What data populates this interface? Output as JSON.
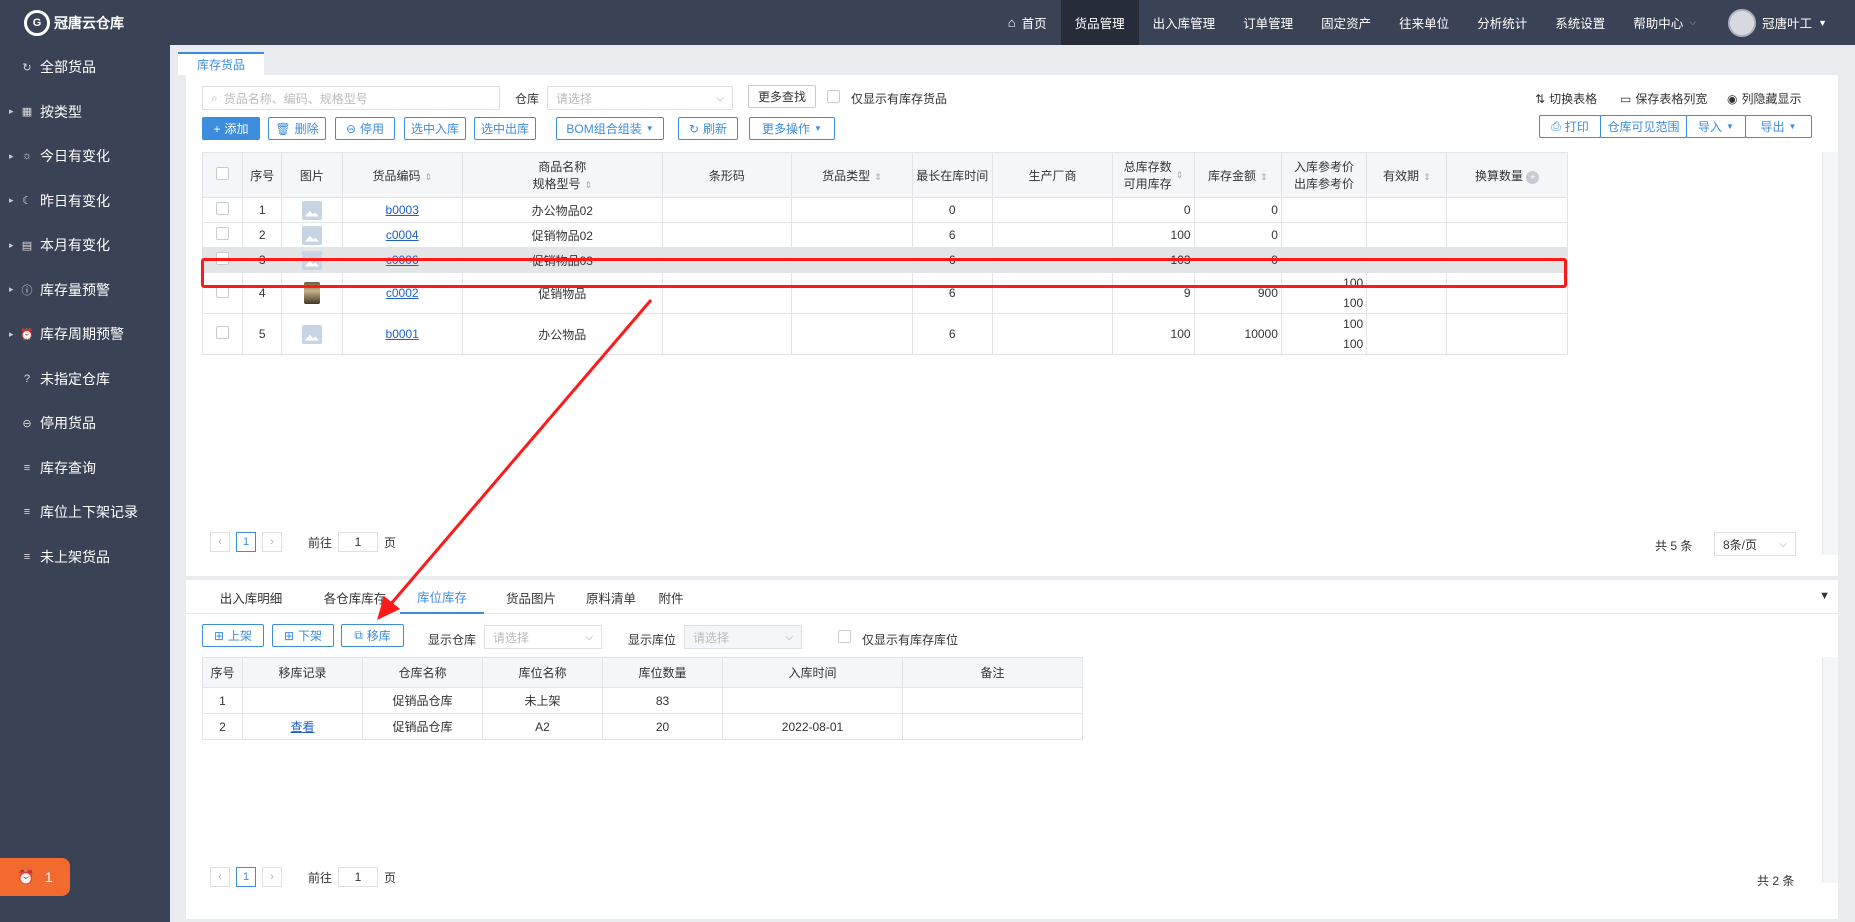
{
  "app": {
    "title": "冠唐云仓库",
    "logo_text": "G"
  },
  "sidebar": {
    "items": [
      {
        "label": "全部货品",
        "icon": "refresh-icon",
        "glyph": "↻",
        "arrow": ""
      },
      {
        "label": "按类型",
        "icon": "grid-icon",
        "glyph": "▦",
        "arrow": "▸"
      },
      {
        "label": "今日有变化",
        "icon": "sun-icon",
        "glyph": "☼",
        "arrow": "▸"
      },
      {
        "label": "昨日有变化",
        "icon": "moon-icon",
        "glyph": "☾",
        "arrow": "▸"
      },
      {
        "label": "本月有变化",
        "icon": "calendar-icon",
        "glyph": "▤",
        "arrow": "▸"
      },
      {
        "label": "库存量预警",
        "icon": "alert-icon",
        "glyph": "ⓘ",
        "arrow": "▸"
      },
      {
        "label": "库存周期预警",
        "icon": "alarm-clock-icon",
        "glyph": "⏰",
        "arrow": "▸"
      },
      {
        "label": "未指定仓库",
        "icon": "question-icon",
        "glyph": "?",
        "arrow": ""
      },
      {
        "label": "停用货品",
        "icon": "minus-circle-icon",
        "glyph": "⊖",
        "arrow": ""
      },
      {
        "label": "库存查询",
        "icon": "list-icon",
        "glyph": "≡",
        "arrow": ""
      },
      {
        "label": "库位上下架记录",
        "icon": "list-icon",
        "glyph": "≡",
        "arrow": ""
      },
      {
        "label": "未上架货品",
        "icon": "list-icon",
        "glyph": "≡",
        "arrow": ""
      }
    ],
    "alarm_count": "1"
  },
  "topnav": {
    "items": [
      "首页",
      "货品管理",
      "出入库管理",
      "订单管理",
      "固定资产",
      "往来单位",
      "分析统计",
      "系统设置",
      "帮助中心"
    ],
    "active_index": 1,
    "user_name": "冠唐叶工"
  },
  "page_tab": "库存货品",
  "toolbar": {
    "search_placeholder": "货品名称、编码、规格型号",
    "warehouse_label": "仓库",
    "warehouse_placeholder": "请选择",
    "more_search": "更多查找",
    "only_stock_label": "仅显示有库存货品",
    "switch_table": "切换表格",
    "save_width": "保存表格列宽",
    "hide_columns": "列隐藏显示",
    "buttons": [
      "添加",
      "删除",
      "停用",
      "选中入库",
      "选中出库",
      "BOM组合组装",
      "刷新",
      "更多操作"
    ],
    "right_buttons": [
      "打印",
      "仓库可见范围",
      "导入",
      "导出"
    ]
  },
  "goods_table": {
    "headers": {
      "seq": "序号",
      "img": "图片",
      "code": "货品编码",
      "name1": "商品名称",
      "name2": "规格型号",
      "barcode": "条形码",
      "type": "货品类型",
      "longest": "最长在库时间",
      "maker": "生产厂商",
      "stock1": "总库存数",
      "stock2": "可用库存",
      "amount": "库存金额",
      "ref1": "入库参考价",
      "ref2": "出库参考价",
      "expiry": "有效期",
      "convert": "换算数量"
    },
    "rows": [
      {
        "seq": "1",
        "code": "b0003",
        "name": "办公物品02",
        "longest": "0",
        "stock": "0",
        "amount": "0",
        "in_price": "",
        "out_price": "",
        "img": "placeholder"
      },
      {
        "seq": "2",
        "code": "c0004",
        "name": "促销物品02",
        "longest": "6",
        "stock": "100",
        "amount": "0",
        "in_price": "",
        "out_price": "",
        "img": "placeholder"
      },
      {
        "seq": "3",
        "code": "c0006",
        "name": "促销物品03",
        "longest": "6",
        "stock": "103",
        "amount": "0",
        "in_price": "",
        "out_price": "",
        "img": "placeholder"
      },
      {
        "seq": "4",
        "code": "c0002",
        "name": "促销物品",
        "longest": "6",
        "stock": "9",
        "amount": "900",
        "in_price": "100",
        "out_price": "100",
        "img": "book"
      },
      {
        "seq": "5",
        "code": "b0001",
        "name": "办公物品",
        "longest": "6",
        "stock": "100",
        "amount": "10000",
        "in_price": "100",
        "out_price": "100",
        "img": "placeholder"
      }
    ],
    "selected_row": 2
  },
  "pager_top": {
    "current": "1",
    "goto_label": "前往",
    "goto_value": "1",
    "page_suffix": "页",
    "total": "共 5 条",
    "page_size": "8条/页"
  },
  "bottom": {
    "tabs": [
      "出入库明细",
      "各仓库库存",
      "库位库存",
      "货品图片",
      "原料清单",
      "附件"
    ],
    "active_tab": 2,
    "buttons": [
      "上架",
      "下架",
      "移库"
    ],
    "show_warehouse_label": "显示仓库",
    "show_warehouse_placeholder": "请选择",
    "show_location_label": "显示库位",
    "show_location_placeholder": "请选择",
    "only_stock_location": "仅显示有库存库位",
    "headers": [
      "序号",
      "移库记录",
      "仓库名称",
      "库位名称",
      "库位数量",
      "入库时间",
      "备注"
    ],
    "rows": [
      [
        "1",
        "",
        "促销品仓库",
        "未上架",
        "83",
        "",
        ""
      ],
      [
        "2",
        "查看",
        "促销品仓库",
        "A2",
        "20",
        "2022-08-01",
        ""
      ]
    ]
  },
  "pager_bottom": {
    "current": "1",
    "goto_label": "前往",
    "goto_value": "1",
    "page_suffix": "页",
    "total": "共 2 条"
  },
  "colors": {
    "accent": "#3c8dde",
    "sidebar": "#3a4255",
    "highlight": "#ff1a1a",
    "alarm": "#f26a2e"
  }
}
